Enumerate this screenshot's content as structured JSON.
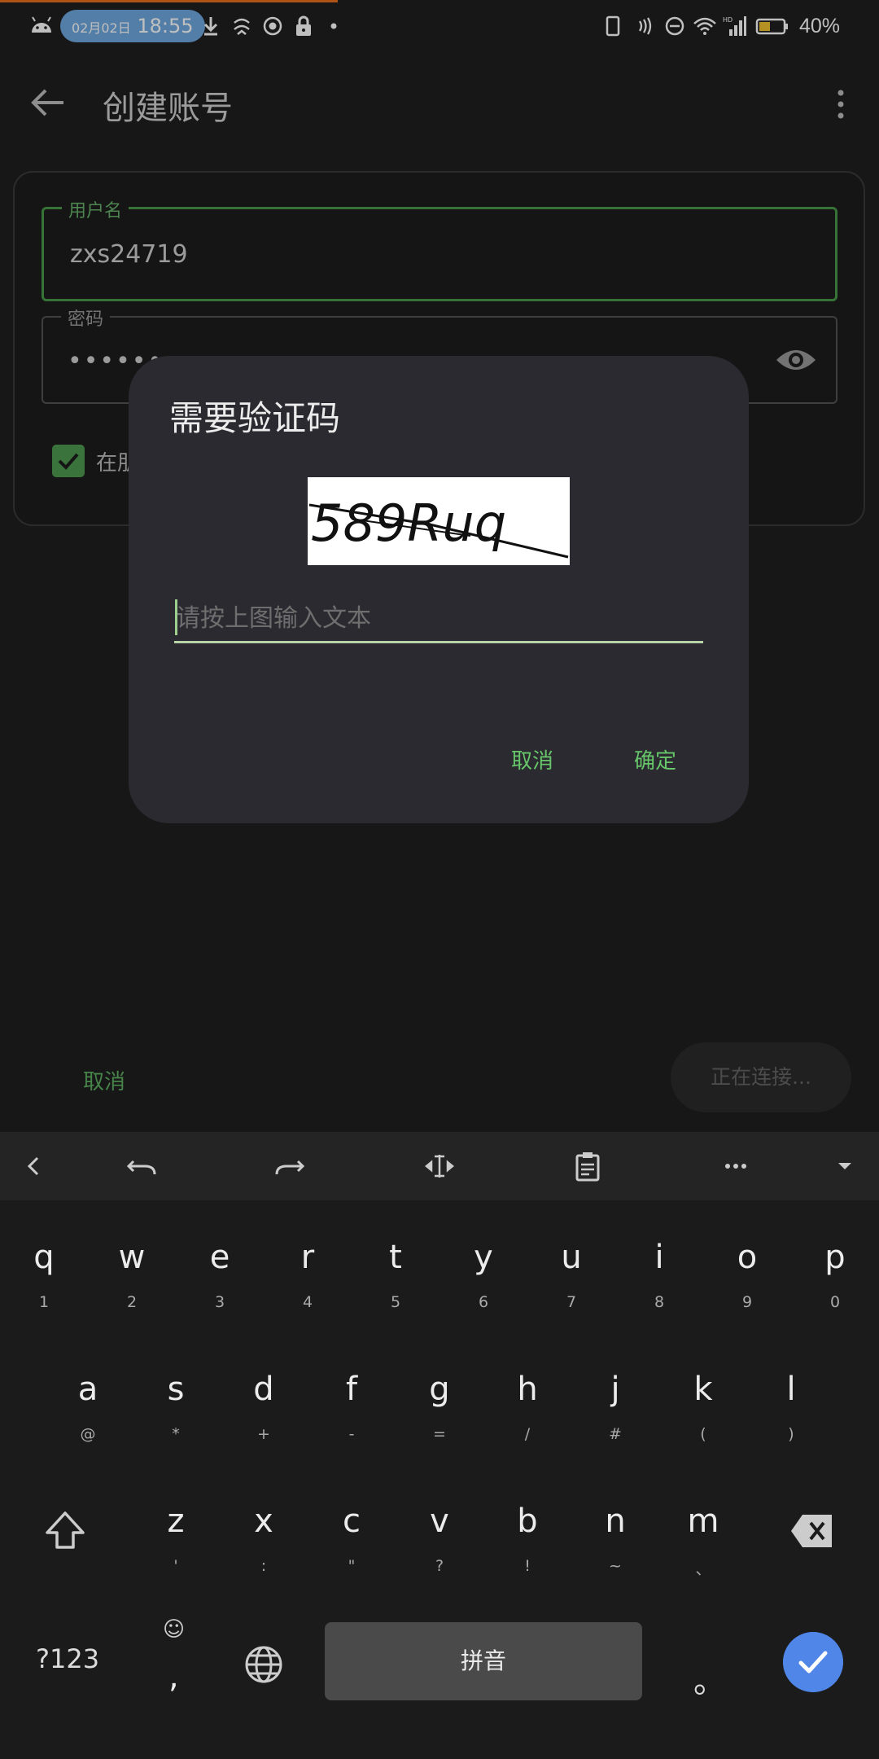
{
  "status_bar": {
    "date": "02月02日",
    "time": "18:55",
    "battery": "40%",
    "icons": [
      "android-icon",
      "download-icon",
      "vpn-icon",
      "record-icon",
      "lock-icon",
      "dot-icon",
      "phone-icon",
      "nfc-icon",
      "dnd-icon",
      "wifi-icon",
      "signal-icon",
      "battery-icon"
    ]
  },
  "app_bar": {
    "title": "创建账号"
  },
  "form": {
    "username_label": "用户名",
    "username_value": "zxs24719",
    "password_label": "密码",
    "password_value": "•••••••••",
    "checkbox_label": "在朋"
  },
  "dialog": {
    "title": "需要验证码",
    "captcha_text": "589Ruq",
    "input_placeholder": "请按上图输入文本",
    "cancel_label": "取消",
    "ok_label": "确定"
  },
  "bottom": {
    "cancel_label": "取消",
    "connecting_label": "正在连接..."
  },
  "keyboard": {
    "toolbar": [
      "chevron-left-icon",
      "undo-icon",
      "redo-icon",
      "cursor-move-icon",
      "clipboard-icon",
      "more-icon",
      "collapse-icon"
    ],
    "row1": [
      {
        "k": "q",
        "s": "1"
      },
      {
        "k": "w",
        "s": "2"
      },
      {
        "k": "e",
        "s": "3"
      },
      {
        "k": "r",
        "s": "4"
      },
      {
        "k": "t",
        "s": "5"
      },
      {
        "k": "y",
        "s": "6"
      },
      {
        "k": "u",
        "s": "7"
      },
      {
        "k": "i",
        "s": "8"
      },
      {
        "k": "o",
        "s": "9"
      },
      {
        "k": "p",
        "s": "0"
      }
    ],
    "row2": [
      {
        "k": "a",
        "s": "@"
      },
      {
        "k": "s",
        "s": "*"
      },
      {
        "k": "d",
        "s": "+"
      },
      {
        "k": "f",
        "s": "-"
      },
      {
        "k": "g",
        "s": "="
      },
      {
        "k": "h",
        "s": "/"
      },
      {
        "k": "j",
        "s": "#"
      },
      {
        "k": "k",
        "s": "("
      },
      {
        "k": "l",
        "s": ")"
      }
    ],
    "row3": [
      {
        "k": "z",
        "s": "'"
      },
      {
        "k": "x",
        "s": ":"
      },
      {
        "k": "c",
        "s": "\""
      },
      {
        "k": "v",
        "s": "?"
      },
      {
        "k": "b",
        "s": "!"
      },
      {
        "k": "n",
        "s": "~"
      },
      {
        "k": "m",
        "s": "、"
      }
    ],
    "symbols_label": "?123",
    "emoji_label": "☺",
    "comma_label": ",",
    "space_label": "拼音",
    "period_label": "。",
    "accent_color": "#4f86e8"
  }
}
